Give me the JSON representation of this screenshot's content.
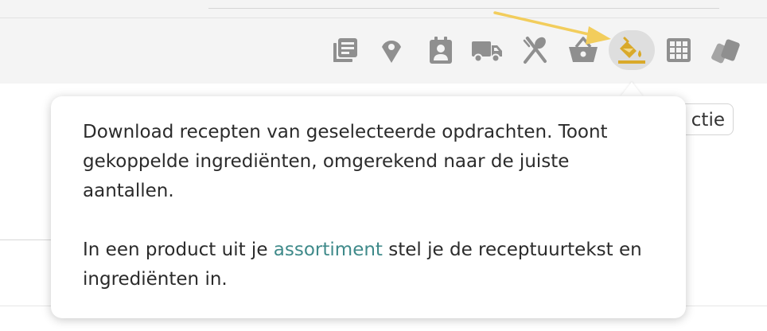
{
  "toolbar": {
    "icons": [
      {
        "name": "recipes-icon"
      },
      {
        "name": "location-icon"
      },
      {
        "name": "calendar-contact-icon"
      },
      {
        "name": "truck-icon"
      },
      {
        "name": "cutlery-icon"
      },
      {
        "name": "basket-icon"
      },
      {
        "name": "paint-bucket-icon",
        "active": true
      },
      {
        "name": "grid-icon"
      },
      {
        "name": "tags-icon"
      }
    ],
    "icon_color": "#8f8f8f",
    "active_icon_color": "#d9a92a",
    "active_background": "#dedede"
  },
  "background": {
    "action_button_label": "ctie"
  },
  "tooltip": {
    "paragraph1": "Download recepten van geselecteerde opdrachten. Toont gekoppelde ingrediënten, omgerekend naar de juiste aantallen.",
    "paragraph2_before": "In een product uit je ",
    "paragraph2_link": "assortiment",
    "paragraph2_after": " stel je de receptuurtekst en ingrediënten in.",
    "link_color": "#3f8a8a"
  },
  "annotation": {
    "arrow_color": "#f2cd5c"
  }
}
